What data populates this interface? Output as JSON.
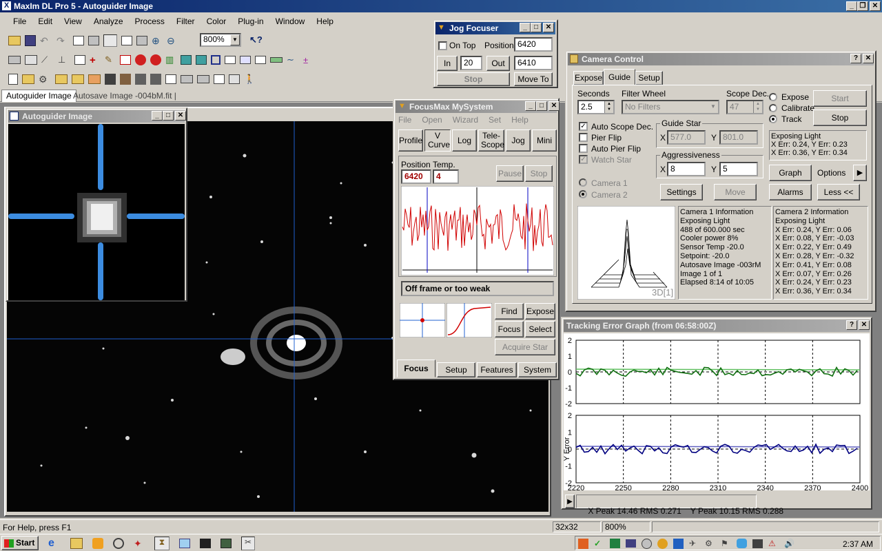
{
  "app": {
    "title": "MaxIm DL Pro 5 - Autoguider Image"
  },
  "menu": [
    "File",
    "Edit",
    "View",
    "Analyze",
    "Process",
    "Filter",
    "Color",
    "Plug-in",
    "Window",
    "Help"
  ],
  "toolbar": {
    "zoom_value": "800%"
  },
  "doc_tabs": [
    "Autoguider Image",
    "Autosave Image -004bM.fit"
  ],
  "autoguider": {
    "title": "Autoguider Image"
  },
  "jog": {
    "title": "Jog Focuser",
    "on_top": "On Top",
    "position_label": "Position",
    "position_value": "6420",
    "in": "In",
    "step_value": "20",
    "out": "Out",
    "target_value": "6410",
    "stop": "Stop",
    "move_to": "Move To"
  },
  "focusmax": {
    "title": "FocusMax  MySystem",
    "menu": [
      "File",
      "Open",
      "Wizard",
      "Set",
      "Help"
    ],
    "buttons": {
      "profile": "Profile",
      "vcurve": "V Curve",
      "log": "Log",
      "telescope": "Tele- Scope",
      "jog": "Jog",
      "mini": "Mini"
    },
    "position_label": "Position",
    "temp_label": "Temp.",
    "position_value": "6420",
    "temp_value": "4",
    "pause": "Pause",
    "stop": "Stop",
    "status": "Off frame or too weak",
    "find": "Find",
    "expose": "Expose",
    "focus": "Focus",
    "select": "Select",
    "acquire": "Acquire Star",
    "tabs": [
      "Focus",
      "Setup",
      "Features",
      "System"
    ]
  },
  "camera": {
    "title": "Camera Control",
    "tabs": [
      "Expose",
      "Guide",
      "Setup"
    ],
    "seconds_label": "Seconds",
    "seconds_value": "2.5",
    "filter_label": "Filter Wheel",
    "filter_value": "No Filters",
    "scope_dec_label": "Scope Dec.",
    "scope_dec_value": "47",
    "mode_expose": "Expose",
    "mode_calibrate": "Calibrate",
    "mode_track": "Track",
    "start": "Start",
    "stop": "Stop",
    "auto_scope_dec": "Auto Scope Dec.",
    "pier_flip": "Pier Flip",
    "auto_pier_flip": "Auto Pier Flip",
    "watch_star": "Watch Star",
    "guide_star_label": "Guide Star",
    "gs_x_label": "X",
    "gs_x": "577.0",
    "gs_y_label": "Y",
    "gs_y": "801.0",
    "aggr_label": "Aggressiveness",
    "ag_x_label": "X",
    "ag_x": "8",
    "ag_y_label": "Y",
    "ag_y": "5",
    "camera1": "Camera 1",
    "camera2": "Camera 2",
    "settings": "Settings",
    "move": "Move",
    "alarms": "Alarms",
    "less": "Less <<",
    "graph": "Graph",
    "options": "Options",
    "status_lines": [
      "Exposing Light",
      "X Err: 0.24, Y Err: 0.23",
      "X Err: 0.36, Y Err: 0.34"
    ],
    "profile_label": "3D[1]",
    "cam1_info": [
      "Camera 1 Information",
      "Exposing Light",
      "488 of 600.000 sec",
      "Cooler power 8%",
      "Sensor Temp -20.0",
      "Setpoint: -20.0",
      "Autosave Image -003rM",
      "Image 1 of 1",
      "Elapsed 8:14 of 10:05"
    ],
    "cam2_info": [
      "Camera 2 Information",
      "Exposing Light",
      "X Err: 0.24, Y Err: 0.06",
      "X Err: 0.08, Y Err: -0.03",
      "X Err: 0.22, Y Err: 0.49",
      "X Err: 0.28, Y Err: -0.32",
      "X Err: 0.41, Y Err: 0.08",
      "X Err: 0.07, Y Err: 0.26",
      "X Err: 0.24, Y Err: 0.23",
      "X Err: 0.36, Y Err: 0.34"
    ]
  },
  "tracking": {
    "title": "Tracking Error Graph (from 06:58:00Z)",
    "y_ticks": [
      "2",
      "1",
      "0",
      "-1",
      "-2"
    ],
    "x_ticks": [
      "2220",
      "2250",
      "2280",
      "2310",
      "2340",
      "2370",
      "2400"
    ],
    "y_error_label": "Y Error",
    "status": "X Peak 14.46 RMS 0.271    Y Peak 10.15 RMS 0.288"
  },
  "statusbar": {
    "help": "For Help, press F1",
    "size": "32x32",
    "zoom": "800%"
  },
  "taskbar": {
    "start": "Start",
    "clock": "2:37 AM"
  }
}
